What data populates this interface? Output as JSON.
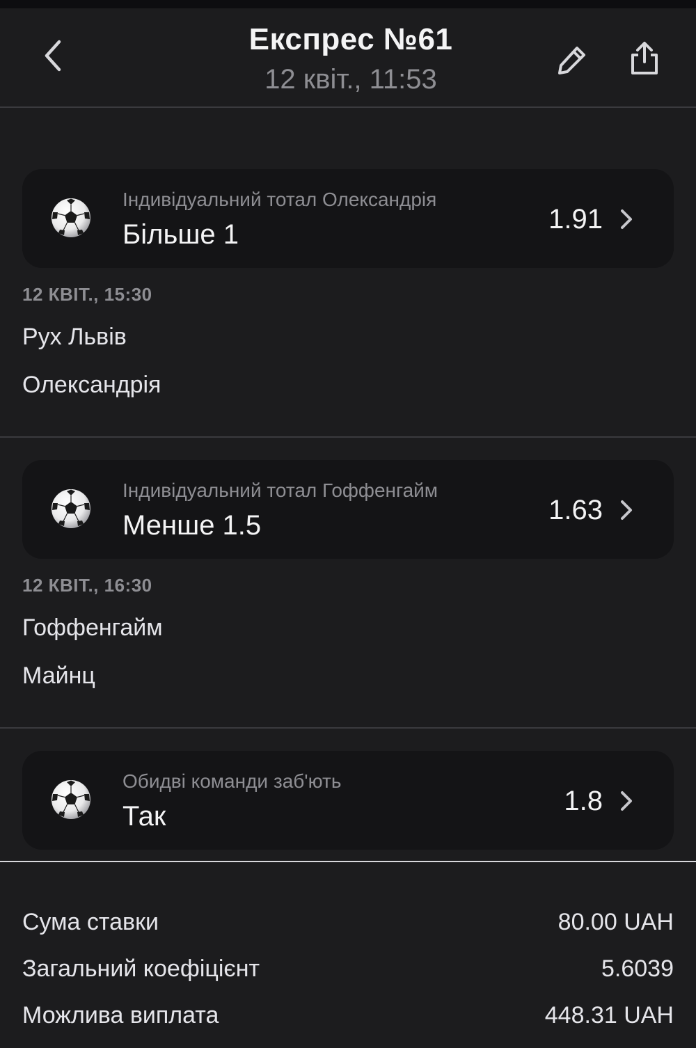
{
  "header": {
    "title": "Експрес №61",
    "subtitle": "12 квіт., 11:53",
    "back_icon": "chevron-left-icon",
    "edit_icon": "pencil-icon",
    "share_icon": "share-icon"
  },
  "bets": [
    {
      "market": "Індивідуальний тотал Олександрія",
      "outcome": "Більше 1",
      "odds": "1.91",
      "icon": "soccer-ball-icon",
      "date": "12 КВІТ., 15:30",
      "team1": "Рух Львів",
      "team2": "Олександрія"
    },
    {
      "market": "Індивідуальний тотал Гоффенгайм",
      "outcome": "Менше 1.5",
      "odds": "1.63",
      "icon": "soccer-ball-icon",
      "date": "12 КВІТ., 16:30",
      "team1": "Гоффенгайм",
      "team2": "Майнц"
    },
    {
      "market": "Обидві команди заб'ють",
      "outcome": "Так",
      "odds": "1.8",
      "icon": "soccer-ball-icon"
    }
  ],
  "summary": {
    "stake_label": "Сума ставки",
    "stake_value": "80.00 UAH",
    "total_odds_label": "Загальний коефіцієнт",
    "total_odds_value": "5.6039",
    "payout_label": "Можлива виплата",
    "payout_value": "448.31 UAH"
  },
  "colors": {
    "background": "#1c1c1e",
    "card": "#141416",
    "text_primary": "#f4f4f5",
    "text_secondary": "#8e8e93",
    "divider": "#3a3a3e"
  }
}
